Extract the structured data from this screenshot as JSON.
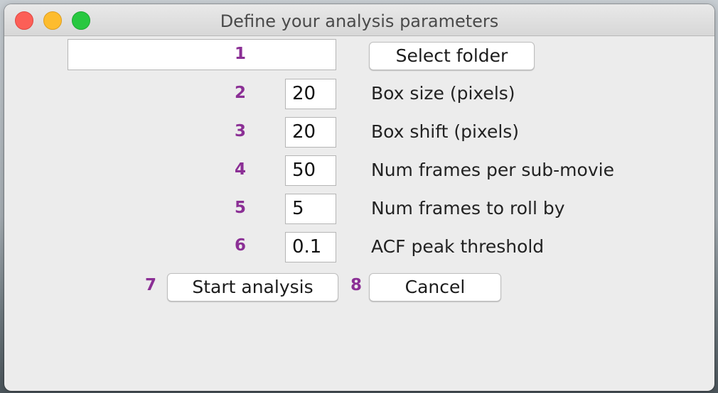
{
  "window": {
    "title": "Define your analysis parameters"
  },
  "folder": {
    "number": "1",
    "value": "",
    "button_label": "Select folder"
  },
  "params": [
    {
      "number": "2",
      "value": "20",
      "label": "Box size (pixels)"
    },
    {
      "number": "3",
      "value": "20",
      "label": "Box shift (pixels)"
    },
    {
      "number": "4",
      "value": "50",
      "label": "Num frames per sub-movie"
    },
    {
      "number": "5",
      "value": "5",
      "label": "Num frames to roll by"
    },
    {
      "number": "6",
      "value": "0.1",
      "label": "ACF peak threshold"
    }
  ],
  "actions": {
    "start_number": "7",
    "start_label": "Start analysis",
    "cancel_number": "8",
    "cancel_label": "Cancel"
  },
  "colors": {
    "annotation_number": "#8b2f95",
    "window_background": "#ececec"
  }
}
